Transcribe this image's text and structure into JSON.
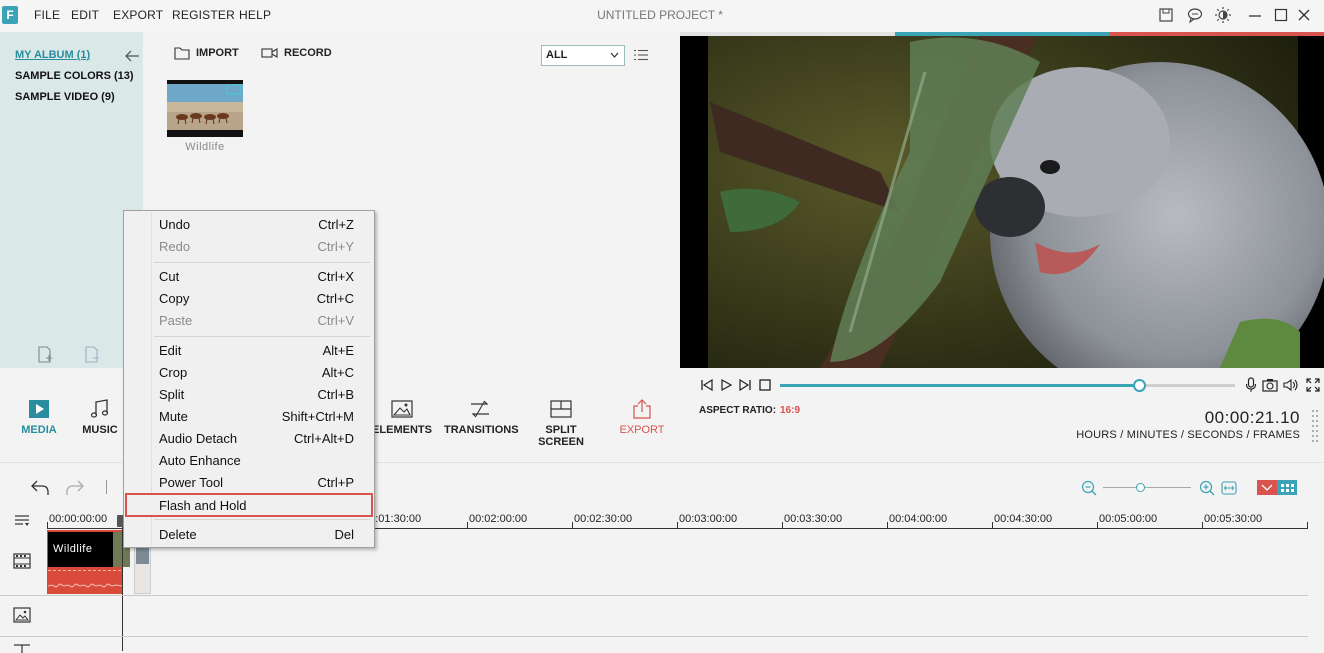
{
  "menubar": {
    "logo": "F",
    "items": [
      "FILE",
      "EDIT",
      "EXPORT",
      "REGISTER",
      "HELP"
    ],
    "project_title": "UNTITLED PROJECT *"
  },
  "album": {
    "items": [
      {
        "label": "MY ALBUM (1)",
        "active": true
      },
      {
        "label": "SAMPLE COLORS (13)",
        "active": false
      },
      {
        "label": "SAMPLE VIDEO (9)",
        "active": false
      }
    ]
  },
  "media": {
    "import_label": "IMPORT",
    "record_label": "RECORD",
    "filter_value": "ALL",
    "clip_label": "Wildlife"
  },
  "toolbar": {
    "media": "MEDIA",
    "music": "MUSIC",
    "elements": "ELEMENTS",
    "transitions": "TRANSITIONS",
    "split_screen": "SPLIT SCREEN",
    "export": "EXPORT"
  },
  "player": {
    "aspect_label": "ASPECT RATIO:",
    "aspect_value": "16:9",
    "timecode": "00:00:21.10",
    "timecode_caption": "HOURS / MINUTES / SECONDS / FRAMES",
    "progress_fraction": 0.79
  },
  "timeline": {
    "ruler": [
      "00:00:00:00",
      "00:01:30:00",
      "00:02:00:00",
      "00:02:30:00",
      "00:03:00:00",
      "00:03:30:00",
      "00:04:00:00",
      "00:04:30:00",
      "00:05:00:00",
      "00:05:30:00"
    ],
    "clip_label": "Wildlife"
  },
  "context_menu": {
    "groups": [
      [
        {
          "label": "Undo",
          "shortcut": "Ctrl+Z",
          "disabled": false
        },
        {
          "label": "Redo",
          "shortcut": "Ctrl+Y",
          "disabled": true
        }
      ],
      [
        {
          "label": "Cut",
          "shortcut": "Ctrl+X",
          "disabled": false
        },
        {
          "label": "Copy",
          "shortcut": "Ctrl+C",
          "disabled": false
        },
        {
          "label": "Paste",
          "shortcut": "Ctrl+V",
          "disabled": true
        }
      ],
      [
        {
          "label": "Edit",
          "shortcut": "Alt+E",
          "disabled": false
        },
        {
          "label": "Crop",
          "shortcut": "Alt+C",
          "disabled": false
        },
        {
          "label": "Split",
          "shortcut": "Ctrl+B",
          "disabled": false
        },
        {
          "label": "Mute",
          "shortcut": "Shift+Ctrl+M",
          "disabled": false
        },
        {
          "label": "Audio Detach",
          "shortcut": "Ctrl+Alt+D",
          "disabled": false
        },
        {
          "label": "Auto Enhance",
          "shortcut": "",
          "disabled": false
        },
        {
          "label": "Power Tool",
          "shortcut": "Ctrl+P",
          "disabled": false
        },
        {
          "label": "Flash and Hold",
          "shortcut": "",
          "disabled": false,
          "highlighted": true
        }
      ],
      [
        {
          "label": "Delete",
          "shortcut": "Del",
          "disabled": false
        }
      ]
    ]
  },
  "colors": {
    "accent": "#3aa3b5",
    "export_red": "#d9534f",
    "album_bg": "#dbe8e8",
    "clip_red": "#d94a3a"
  }
}
